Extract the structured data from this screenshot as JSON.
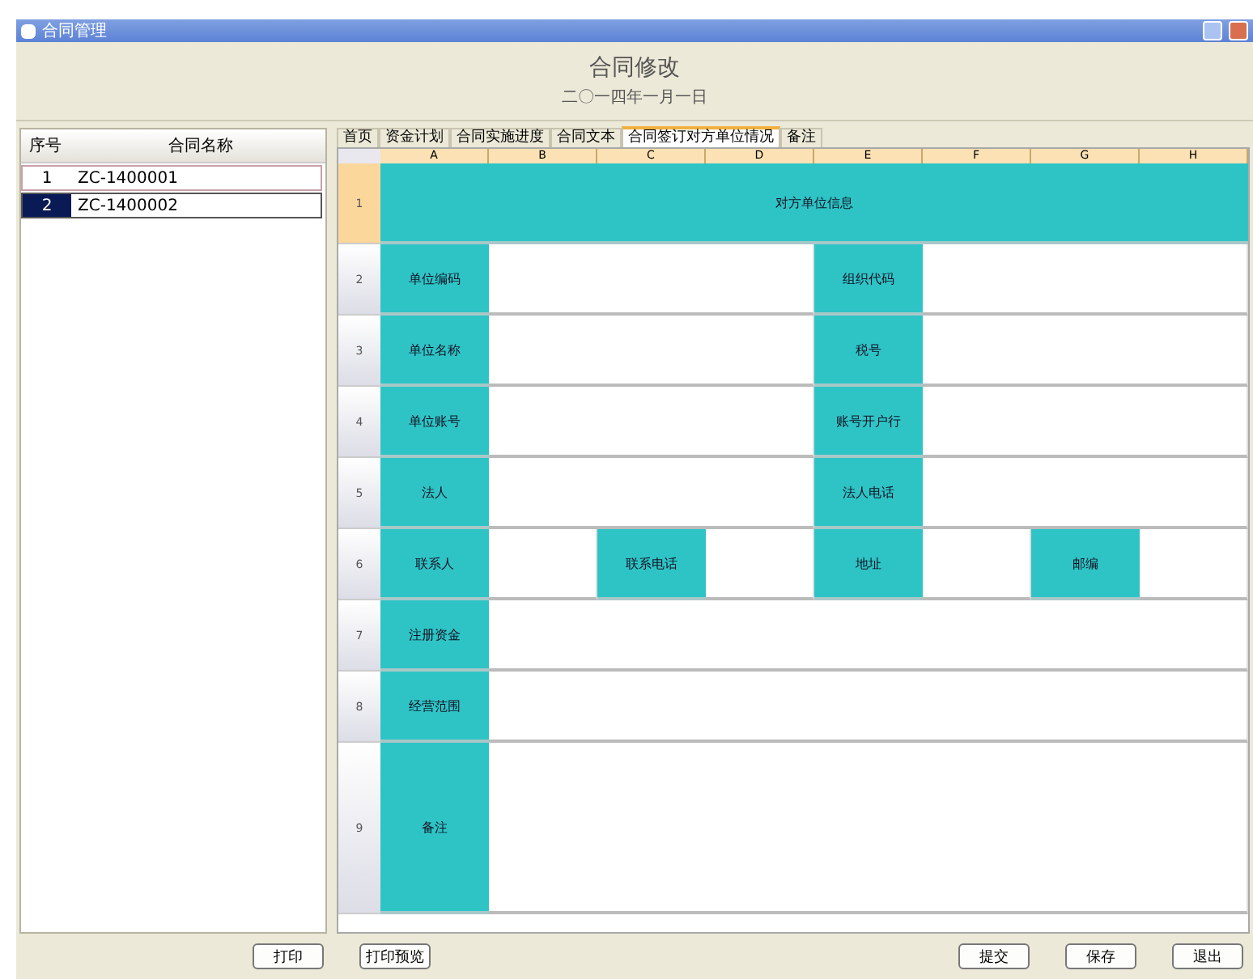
{
  "window": {
    "title": "合同管理"
  },
  "header": {
    "title": "合同修改",
    "date": "二〇一四年一月一日"
  },
  "contract_list": {
    "columns": [
      "序号",
      "合同名称"
    ],
    "rows": [
      {
        "number": "1",
        "name": "ZC-1400001",
        "selected": false
      },
      {
        "number": "2",
        "name": "ZC-1400002",
        "selected": true
      }
    ]
  },
  "tabs": [
    {
      "label": "首页",
      "selected": false
    },
    {
      "label": "资金计划",
      "selected": false
    },
    {
      "label": "合同实施进度",
      "selected": false
    },
    {
      "label": "合同文本",
      "selected": false
    },
    {
      "label": "合同签订对方单位情况",
      "selected": true
    },
    {
      "label": "备注",
      "selected": false
    }
  ],
  "sheet": {
    "columns": [
      "A",
      "B",
      "C",
      "D",
      "E",
      "F",
      "G",
      "H"
    ],
    "rows": [
      {
        "number": "1",
        "cells": [
          {
            "kind": "label",
            "text": "对方单位信息"
          }
        ]
      },
      {
        "number": "2",
        "cells": [
          {
            "kind": "label",
            "text": "单位编码"
          },
          {
            "kind": "value"
          },
          {
            "kind": "label",
            "text": "组织代码"
          },
          {
            "kind": "value"
          }
        ]
      },
      {
        "number": "3",
        "cells": [
          {
            "kind": "label",
            "text": "单位名称"
          },
          {
            "kind": "value"
          },
          {
            "kind": "label",
            "text": "税号"
          },
          {
            "kind": "value"
          }
        ]
      },
      {
        "number": "4",
        "cells": [
          {
            "kind": "label",
            "text": "单位账号"
          },
          {
            "kind": "value"
          },
          {
            "kind": "label",
            "text": "账号开户行"
          },
          {
            "kind": "value"
          }
        ]
      },
      {
        "number": "5",
        "cells": [
          {
            "kind": "label",
            "text": "法人"
          },
          {
            "kind": "value"
          },
          {
            "kind": "label",
            "text": "法人电话"
          },
          {
            "kind": "value"
          }
        ]
      },
      {
        "number": "6",
        "cells": [
          {
            "kind": "label",
            "text": "联系人"
          },
          {
            "kind": "value"
          },
          {
            "kind": "label",
            "text": "联系电话"
          },
          {
            "kind": "value"
          },
          {
            "kind": "label",
            "text": "地址"
          },
          {
            "kind": "value"
          },
          {
            "kind": "label",
            "text": "邮编"
          },
          {
            "kind": "value"
          }
        ]
      },
      {
        "number": "7",
        "cells": [
          {
            "kind": "label",
            "text": "注册资金"
          },
          {
            "kind": "value"
          }
        ]
      },
      {
        "number": "8",
        "cells": [
          {
            "kind": "label",
            "text": "经营范围"
          },
          {
            "kind": "value"
          }
        ]
      },
      {
        "number": "9",
        "cells": [
          {
            "kind": "label",
            "text": "备注"
          },
          {
            "kind": "value"
          }
        ]
      }
    ]
  },
  "left_buttons": [
    "打印",
    "打印预览"
  ],
  "right_buttons": [
    "提交",
    "保存",
    "退出"
  ]
}
